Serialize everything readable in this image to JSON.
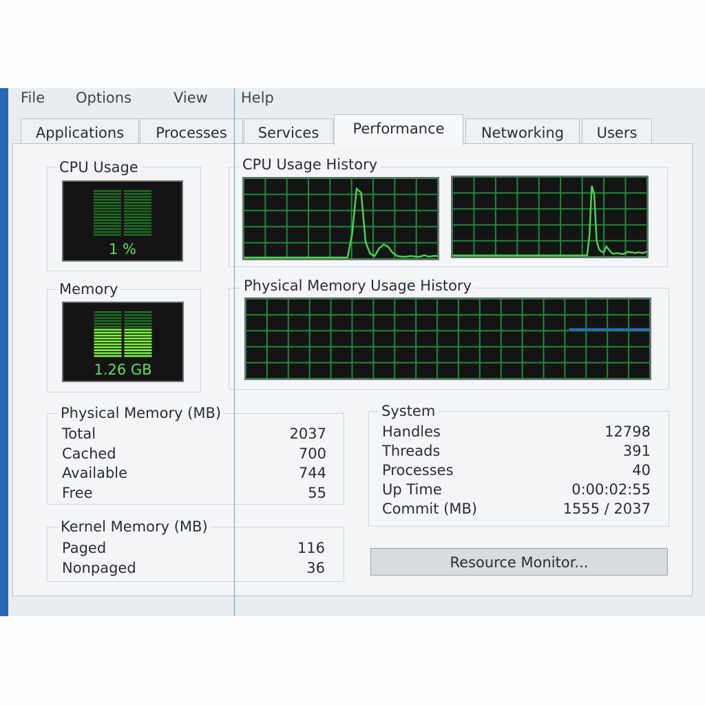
{
  "menu": [
    "File",
    "Options",
    "View",
    "Help"
  ],
  "tabs": [
    "Applications",
    "Processes",
    "Services",
    "Performance",
    "Networking",
    "Users"
  ],
  "active_tab": "Performance",
  "cpu_usage": {
    "title": "CPU Usage",
    "value": "1 %",
    "percent": 1
  },
  "memory": {
    "title": "Memory",
    "value": "1.26 GB"
  },
  "cpu_history": {
    "title": "CPU Usage History",
    "cores": [
      [
        0,
        0,
        0,
        0,
        0,
        0,
        0,
        0,
        0,
        0,
        0,
        0,
        0,
        0,
        0,
        0,
        0,
        0,
        0,
        0,
        0,
        0,
        0,
        0,
        30,
        90,
        85,
        20,
        5,
        2,
        12,
        17,
        14,
        6,
        2,
        1,
        1,
        2,
        1,
        1,
        3,
        1,
        2,
        2
      ],
      [
        0,
        0,
        0,
        0,
        0,
        0,
        0,
        0,
        0,
        0,
        0,
        0,
        0,
        0,
        0,
        0,
        0,
        0,
        0,
        0,
        0,
        0,
        0,
        0,
        0,
        0,
        0,
        0,
        0,
        0,
        0,
        0,
        0,
        0,
        0,
        0,
        0,
        0,
        0,
        0,
        0,
        0,
        0,
        0,
        0,
        0,
        0,
        0,
        0,
        0,
        0,
        0,
        0,
        0,
        0,
        0,
        0,
        25,
        92,
        80,
        20,
        8,
        5,
        4,
        12,
        8,
        4,
        2,
        3,
        3,
        2,
        2,
        3,
        5,
        4,
        4,
        3,
        4,
        4,
        3,
        4,
        5
      ]
    ],
    "line_color": "#4fd04f",
    "grid_color": "#1f8a3a"
  },
  "memory_history": {
    "title": "Physical Memory Usage History",
    "used_percent": 62,
    "visible_from": 0.8,
    "line_color": "#2a62e0"
  },
  "physical_memory": {
    "title": "Physical Memory (MB)",
    "rows": [
      [
        "Total",
        "2037"
      ],
      [
        "Cached",
        "700"
      ],
      [
        "Available",
        "744"
      ],
      [
        "Free",
        "55"
      ]
    ]
  },
  "kernel_memory": {
    "title": "Kernel Memory (MB)",
    "rows": [
      [
        "Paged",
        "116"
      ],
      [
        "Nonpaged",
        "36"
      ]
    ]
  },
  "system": {
    "title": "System",
    "rows": [
      [
        "Handles",
        "12798"
      ],
      [
        "Threads",
        "391"
      ],
      [
        "Processes",
        "40"
      ],
      [
        "Up Time",
        "0:00:02:55"
      ],
      [
        "Commit (MB)",
        "1555 / 2037"
      ]
    ]
  },
  "resource_monitor_label": "Resource Monitor..."
}
